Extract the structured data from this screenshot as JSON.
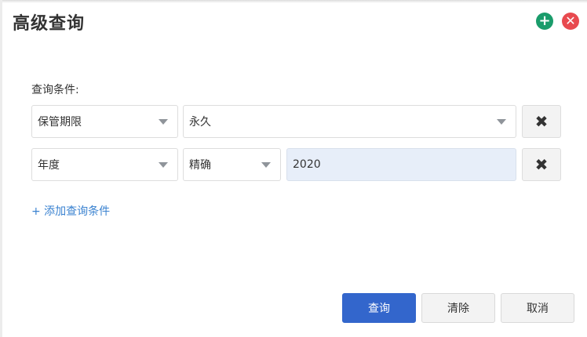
{
  "dialog": {
    "title": "高级查询",
    "add_icon": "plus-circle-icon",
    "close_icon": "close-circle-icon"
  },
  "conditions_label": "查询条件:",
  "conditions": [
    {
      "field": "保管期限",
      "value": "永久"
    },
    {
      "field": "年度",
      "operator": "精确",
      "value": "2020"
    }
  ],
  "delete_icon": "x-icon",
  "add_condition_label": "+ 添加查询条件",
  "buttons": {
    "query": "查询",
    "clear": "清除",
    "cancel": "取消"
  },
  "colors": {
    "primary": "#3366cc",
    "add_green": "#1a9c6b",
    "close_red": "#e84a4f",
    "link_blue": "#3a82d0",
    "input_bg": "#e7eef9"
  }
}
